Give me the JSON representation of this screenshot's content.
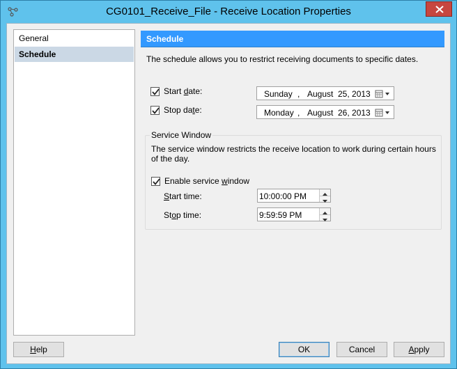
{
  "window": {
    "title": "CG0101_Receive_File - Receive Location Properties",
    "accent": "#5fc2ec",
    "close_color": "#c7463f"
  },
  "nav": {
    "items": [
      {
        "label": "General",
        "selected": false
      },
      {
        "label": "Schedule",
        "selected": true
      }
    ]
  },
  "panel": {
    "header": "Schedule",
    "description": "The schedule allows you to restrict receiving documents to specific dates.",
    "start_date": {
      "label_pre": "Start ",
      "label_key": "d",
      "label_post": "ate:",
      "checked": true,
      "day": "Sunday",
      "sep": ",",
      "month": "August",
      "daynum": "25, 2013"
    },
    "stop_date": {
      "label_pre": "Stop da",
      "label_key": "t",
      "label_post": "e:",
      "checked": true,
      "day": "Monday",
      "sep": ",",
      "month": "August",
      "daynum": "26, 2013"
    },
    "service_window": {
      "title": "Service Window",
      "description": "The service window restricts the receive location to work during certain hours of the day.",
      "enable": {
        "label_pre": "Enable service ",
        "label_key": "w",
        "label_post": "indow",
        "checked": true
      },
      "start_time": {
        "label_key": "S",
        "label_post": "tart time:",
        "value": "10:00:00 PM"
      },
      "stop_time": {
        "label_pre": "St",
        "label_key": "o",
        "label_post": "p time:",
        "value": "9:59:59 PM"
      }
    }
  },
  "buttons": {
    "help": {
      "key": "H",
      "rest": "elp"
    },
    "ok": "OK",
    "cancel": "Cancel",
    "apply": {
      "key": "A",
      "rest": "pply"
    }
  },
  "icons": {
    "app": "receive-location-icon",
    "close": "close-icon",
    "checkbox": "check-icon",
    "calendar": "calendar-icon",
    "dropdown": "chevron-down-icon",
    "spin_up": "chevron-up-icon",
    "spin_down": "chevron-down-icon"
  }
}
